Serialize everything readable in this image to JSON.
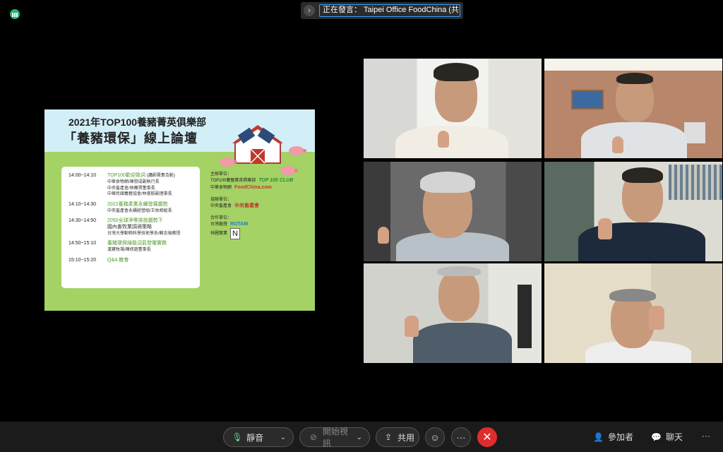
{
  "speaker": {
    "label": "正在發言： Taipei Office FoodChina (共..."
  },
  "slide": {
    "title_line1": "2021年TOP100養豬菁英俱樂部",
    "title_line2": "「養豬環保」線上論壇",
    "schedule": [
      {
        "time": "14:00~14:10",
        "title": "TOP100歡迎致詞",
        "title_note": "(講師賣賓合影)",
        "details": [
          "中華食物網/陳發成副執行長",
          "中央畜產會/林團賢董事長",
          "中華民國養豬協會/林睿毅副理事長"
        ]
      },
      {
        "time": "14:10~14:30",
        "title": "2022養豬產業永續發展趨勢",
        "title_note": "",
        "details": [
          "中央畜產會永續經營組/王佑相組長"
        ]
      },
      {
        "time": "14:30~14:50",
        "title": "2050全球淨零排放趨勢下",
        "title_note": "",
        "details": [
          "國內畜牧業調適策略",
          "台灣大學動物科學技術學系/蘇忠楨教授"
        ]
      },
      {
        "time": "14:50~15:10",
        "title": "養豬環保綠能沼氣發電實務",
        "title_note": "",
        "details": [
          "漢寶牧場/陳修誼董事長"
        ]
      },
      {
        "time": "15:10~15:20",
        "title": "Q&A 散會",
        "title_note": "",
        "details": []
      }
    ],
    "organizers": {
      "host_label": "主辦單位：",
      "hosts": [
        {
          "name": "TOP100養豬菁英俱樂部",
          "logo": "TOP 100 CLUB"
        },
        {
          "name": "中華食物網",
          "logo": "FoodChina.com"
        }
      ],
      "co_label": "協辦單位：",
      "co": [
        {
          "name": "中央畜產會",
          "logo": "中央畜產會"
        }
      ],
      "partner_label": "合作單位：",
      "partners": [
        {
          "name": "台灣龍燈",
          "logo": "ROTAM"
        },
        {
          "name": "祥圃實業",
          "logo": "N"
        }
      ]
    }
  },
  "toolbar": {
    "mute_label": "靜音",
    "video_label": "開始視訊",
    "share_label": "共用",
    "more_label": "···",
    "end_label": "✕",
    "participants_label": "參加者",
    "chat_label": "聊天",
    "overflow_label": "···"
  },
  "colors": {
    "accent_blue": "#3aa0ff",
    "end_red": "#e02c2c",
    "speaker_green": "#22b573",
    "slide_grass": "#a4d264"
  }
}
